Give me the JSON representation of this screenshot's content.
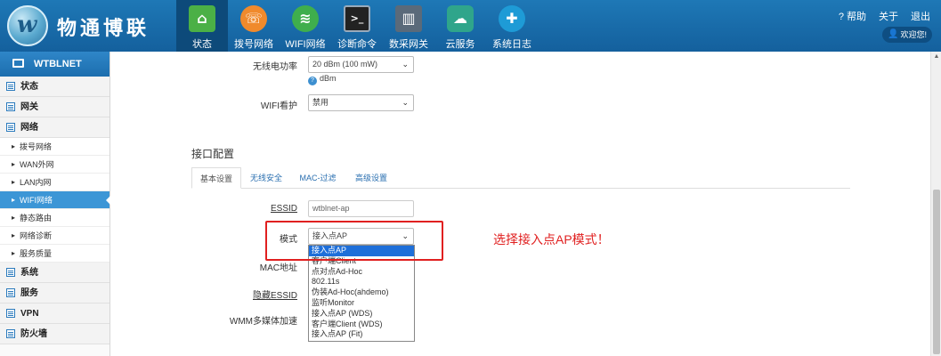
{
  "brand": {
    "name": "物通博联",
    "logo_letter": "w"
  },
  "nav": [
    {
      "label": "状态",
      "icon": "home-icon",
      "glyph": "⌂",
      "active": true
    },
    {
      "label": "拨号网络",
      "icon": "dial-icon",
      "glyph": "☏"
    },
    {
      "label": "WIFI网络",
      "icon": "wifi-icon",
      "glyph": "≋"
    },
    {
      "label": "诊断命令",
      "icon": "terminal-icon",
      "glyph": ">_"
    },
    {
      "label": "数采网关",
      "icon": "data-icon",
      "glyph": "▥"
    },
    {
      "label": "云服务",
      "icon": "cloud-icon",
      "glyph": "☁"
    },
    {
      "label": "系统日志",
      "icon": "stethoscope-icon",
      "glyph": "✚"
    }
  ],
  "top_links": {
    "help": "? 帮助",
    "about": "关于",
    "logout": "退出",
    "welcome": "欢迎您!"
  },
  "sidebar": {
    "title": "WTBLNET",
    "status": "状态",
    "gateway": "网关",
    "network": "网络",
    "network_items": [
      "拨号网络",
      "WAN外网",
      "LAN内网",
      "WIFI网络",
      "静态路由",
      "网络诊断",
      "服务质量"
    ],
    "system": "系统",
    "service": "服务",
    "vpn": "VPN",
    "firewall": "防火墙"
  },
  "wifi_settings": {
    "tx_power_label": "无线电功率",
    "tx_power_value": "20 dBm (100 mW)",
    "tx_power_hint": "dBm",
    "wifi_guard_label": "WIFI看护",
    "wifi_guard_value": "禁用"
  },
  "interface": {
    "title": "接口配置",
    "tabs": [
      "基本设置",
      "无线安全",
      "MAC-过滤",
      "高级设置"
    ],
    "essid_label": "ESSID",
    "essid_value": "wtblnet-ap",
    "mode_label": "模式",
    "mode_value": "接入点AP",
    "mac_label": "MAC地址",
    "hidden_essid_label": "隐藏ESSID",
    "wmm_label": "WMM多媒体加速",
    "mode_options": [
      "接入点AP",
      "客户端Client",
      "点对点Ad-Hoc",
      "802.11s",
      "伪装Ad-Hoc(ahdemo)",
      "监听Monitor",
      "接入点AP (WDS)",
      "客户端Client (WDS)",
      "接入点AP (Fit)"
    ]
  },
  "annotation": "选择接入点AP模式！",
  "colors": {
    "header": "#1a6daa",
    "accent": "#e02020",
    "active_nav": "#0d4a7a"
  }
}
